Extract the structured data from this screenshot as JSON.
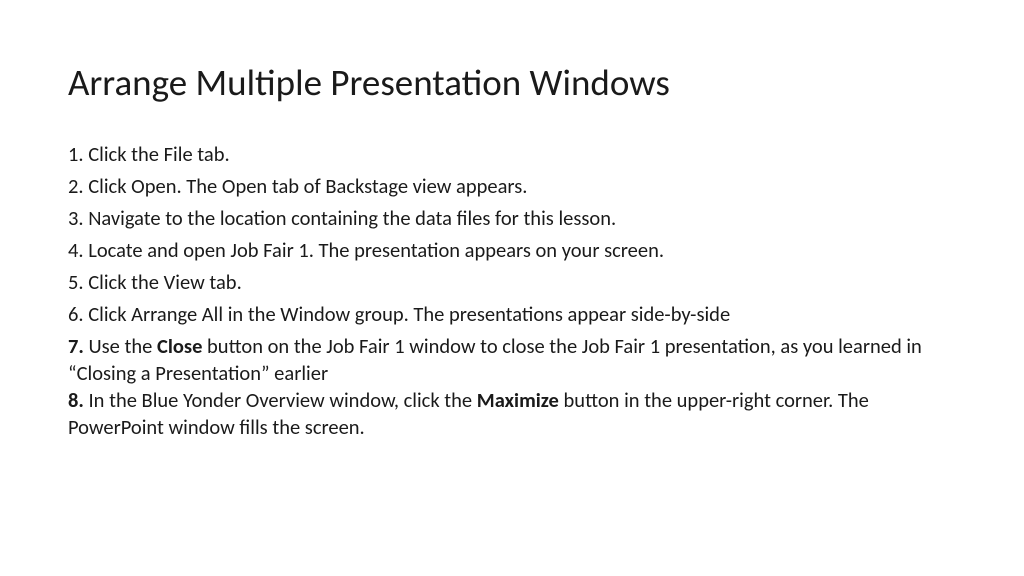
{
  "title": "Arrange Multiple Presentation Windows",
  "steps": {
    "s1": "1. Click the File tab.",
    "s2": "2. Click Open. The Open tab of Backstage view appears.",
    "s3": "3. Navigate to the location containing the data files for this lesson.",
    "s4": "4. Locate and open Job Fair 1. The presentation appears on your screen.",
    "s5": "5. Click the View tab.",
    "s6": "6. Click Arrange All in the Window group. The presentations appear side-by-side",
    "s7_num": "7.",
    "s7_a": " Use the ",
    "s7_bold1": "Close",
    "s7_b": " button on the Job Fair 1 window to close the Job Fair 1 presentation, as you learned in “Closing a Presentation” earlier",
    "s8_num": "8.",
    "s8_a": " In the Blue Yonder Overview window, click the ",
    "s8_bold1": "Maximize",
    "s8_b": " button in the upper-right corner. The PowerPoint window fills the screen."
  }
}
